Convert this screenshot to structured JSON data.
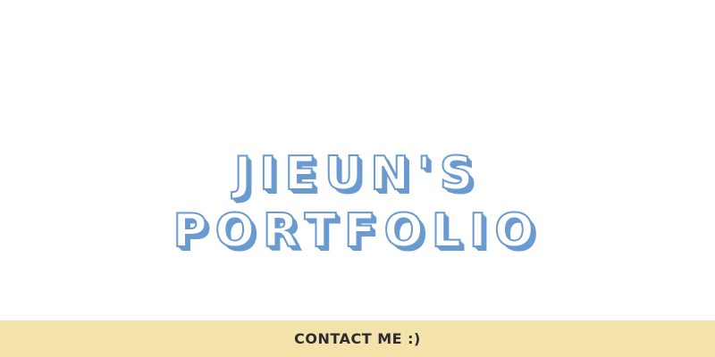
{
  "hero": {
    "title_line_1": "JIEUN'S",
    "title_line_2": "PORTFOLIO"
  },
  "footer": {
    "contact_label": "CONTACT ME :)"
  },
  "colors": {
    "background": "#ffffff",
    "title_outline": "#6a9bd0",
    "footer_bar": "#f3e2a9",
    "footer_text": "#2b2b33"
  }
}
